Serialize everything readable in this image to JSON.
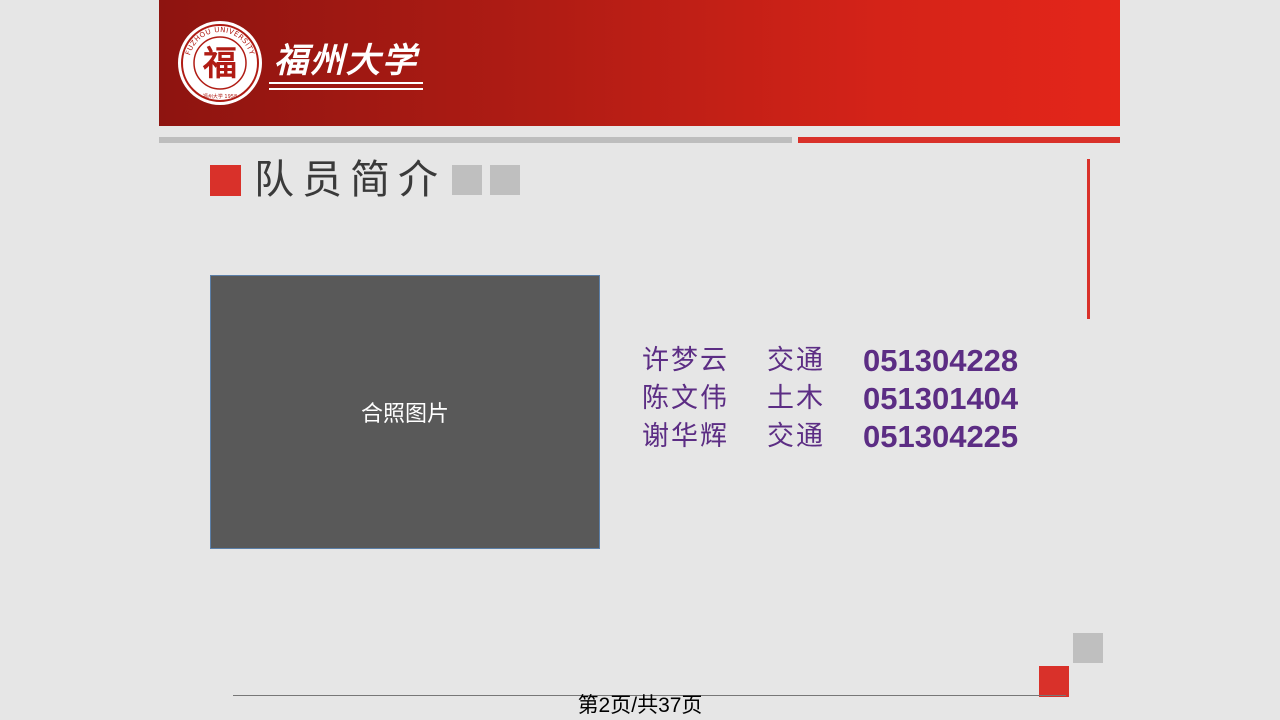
{
  "header": {
    "university_logo": "fuzhou-university-seal",
    "seal_text": "FUZHOU UNIVERSITY",
    "seal_character": "福",
    "seal_bottom_text": "福州大学 1958",
    "script_title": "福州大学"
  },
  "slide": {
    "title": "队员简介",
    "photo_placeholder": "合照图片"
  },
  "members": [
    {
      "name": "许梦云",
      "dept": "交通",
      "id": "051304228"
    },
    {
      "name": "陈文伟",
      "dept": "土木",
      "id": "051301404"
    },
    {
      "name": "谢华辉",
      "dept": "交通",
      "id": "051304225"
    }
  ],
  "footer": {
    "page_indicator": "第2页/共37页"
  },
  "colors": {
    "brand_red": "#d9312a",
    "accent_gray": "#bfbfbf",
    "member_text": "#5c2d84",
    "header_dark": "#8e1410",
    "header_light": "#e4261a"
  }
}
